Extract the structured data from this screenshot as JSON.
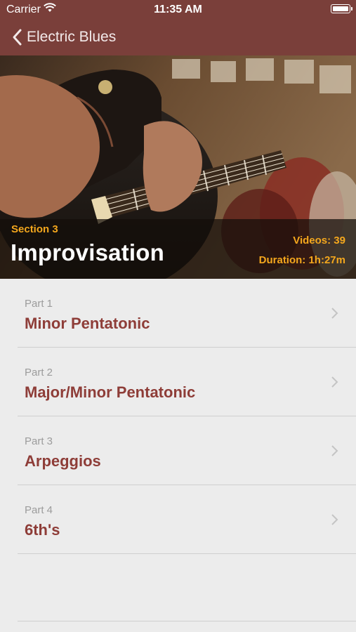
{
  "status_bar": {
    "carrier": "Carrier",
    "time": "11:35 AM"
  },
  "nav": {
    "back_label": "Electric Blues"
  },
  "hero": {
    "section_label": "Section 3",
    "title": "Improvisation",
    "videos": "Videos: 39",
    "duration": "Duration: 1h:27m"
  },
  "parts": [
    {
      "part": "Part 1",
      "name": "Minor Pentatonic"
    },
    {
      "part": "Part 2",
      "name": "Major/Minor Pentatonic"
    },
    {
      "part": "Part 3",
      "name": "Arpeggios"
    },
    {
      "part": "Part 4",
      "name": "6th's"
    }
  ],
  "colors": {
    "nav_background": "#7a3f3a",
    "accent_orange": "#f4a71d",
    "item_title": "#8e3d38",
    "list_background": "#ececec"
  }
}
